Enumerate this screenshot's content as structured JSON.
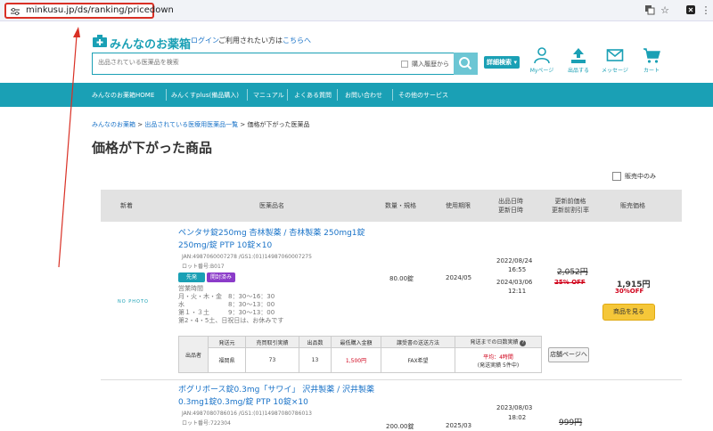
{
  "browser": {
    "url": "minkusu.jp/ds/ranking/pricedown"
  },
  "header": {
    "logo_text": "みんなのお薬箱",
    "login_label": "ログイン",
    "welcome_text": "ご利用されたい方は",
    "here_link": "こちらへ",
    "search_placeholder": "出品されている医薬品を検索",
    "history_label": "購入履歴から",
    "advanced_search_label": "詳細検索",
    "icons": [
      {
        "name": "mypage-icon",
        "label": "Myページ"
      },
      {
        "name": "upload-icon",
        "label": "出品する"
      },
      {
        "name": "mail-icon",
        "label": "メッセージ"
      },
      {
        "name": "cart-icon",
        "label": "カート"
      }
    ]
  },
  "nav": {
    "items": [
      "みんなのお薬箱HOME",
      "みんくすplus(備品購入)",
      "マニュアル",
      "よくある質問",
      "お問い合わせ",
      "その他のサービス"
    ]
  },
  "breadcrumb": {
    "items": [
      "みんなのお薬箱",
      "出品されている医療用医薬品一覧",
      "価格が下がった医薬品"
    ],
    "separator": ">"
  },
  "page": {
    "title": "価格が下がった商品",
    "on_sale_only_label": "販売中のみ"
  },
  "table": {
    "headers": {
      "new": "新着",
      "name": "医薬品名",
      "qty": "数量・規格",
      "expiry": "使用期限",
      "listed1": "出品日時",
      "listed2": "更新日時",
      "before1": "更新前価格",
      "before2": "更新前割引率",
      "price": "販売価格"
    },
    "rows": [
      {
        "no_image": "NO PHOTO",
        "name_line1": "ペンタサ錠250mg 杏林製薬 / 杏林製薬 250mg1錠",
        "name_line2": "250mg/錠 PTP 10錠×10",
        "jan": "JAN:4987060007278 /GS1:(01)14987060007275",
        "lot": "ロット番号:B017",
        "badge1": "先発",
        "badge2": "開封済み",
        "hours": "営業時間\n月・火・木・金　8：30〜16：30\n水　　　　　　　8：30〜13：00\n第１・３土　　　9：30〜13：00\n第2・4・5土、日祝日は、お休みです",
        "qty": "80.00錠",
        "expiry": "2024/05",
        "listed_date": "2022/08/24",
        "listed_time": "16:55",
        "updated_date": "2024/03/06",
        "updated_time": "12:11",
        "old_price": "2,052円",
        "old_discount": "25% OFF",
        "price": "1,915円",
        "discount": "30%OFF",
        "buy_label": "商品を見る",
        "seller": {
          "row_label": "出品者",
          "headers": [
            "発送元",
            "売買取引実績",
            "出品数",
            "最低購入金額",
            "譲受書の送送方法",
            "発送までの日数実績"
          ],
          "values": [
            "福岡県",
            "73",
            "13",
            "1,500円",
            "FAX希望"
          ],
          "ship_avg": "平均：4時間",
          "ship_count": "(発送実績 5件中)",
          "store_label": "店舗ページへ"
        }
      },
      {
        "name_line1": "ボグリボース錠0.3mg「サワイ」 沢井製薬 / 沢井製薬",
        "name_line2": "0.3mg1錠0.3mg/錠 PTP 10錠×10",
        "jan": "JAN:4987080786016 /GS1:(01)14987080786013",
        "lot": "ロット番号:722304",
        "qty": "200.00錠",
        "expiry": "2025/03",
        "listed_date": "2023/08/03",
        "listed_time": "18:02",
        "old_price": "999円"
      }
    ]
  },
  "colors": {
    "brand": "#1aa0b5",
    "link": "#1a73c8",
    "sale_red": "#d0021b",
    "buy_button": "#f5c739",
    "annotation": "#d93025"
  }
}
